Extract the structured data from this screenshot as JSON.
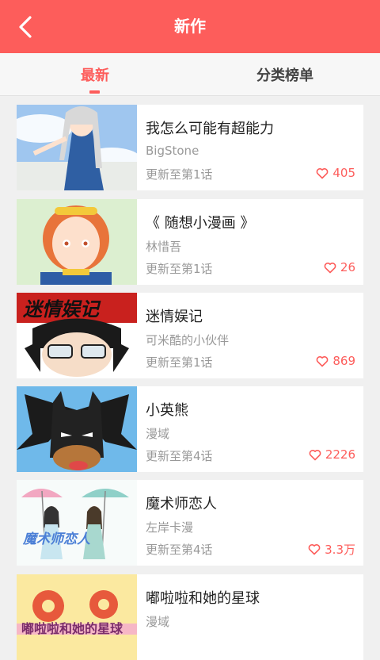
{
  "header": {
    "title": "新作",
    "back_icon": "back-arrow-icon"
  },
  "tabs": [
    {
      "label": "最新",
      "active": true
    },
    {
      "label": "分类榜单",
      "active": false
    }
  ],
  "colors": {
    "accent": "#fd5d5b",
    "heart": "#fd5d5b",
    "header_bg": "#fd5d5b"
  },
  "comics": [
    {
      "title": "我怎么可能有超能力",
      "author": "BigStone",
      "update": "更新至第1话",
      "likes": "405"
    },
    {
      "title": "《 随想小漫画 》",
      "author": "林惜吾",
      "update": "更新至第1话",
      "likes": "26"
    },
    {
      "title": "迷情娱记",
      "author": "可米酷的小伙伴",
      "update": "更新至第1话",
      "likes": "869",
      "cover_text": "迷情娱记"
    },
    {
      "title": "小英熊",
      "author": "漫域",
      "update": "更新至第4话",
      "likes": "2226"
    },
    {
      "title": "魔术师恋人",
      "author": "左岸卡漫",
      "update": "更新至第4话",
      "likes": "3.3万",
      "cover_text": "魔术师恋人"
    },
    {
      "title": "嘟啦啦和她的星球",
      "author": "漫域",
      "update": "",
      "likes": "",
      "cover_text": "嘟啦啦和她的星球"
    }
  ]
}
